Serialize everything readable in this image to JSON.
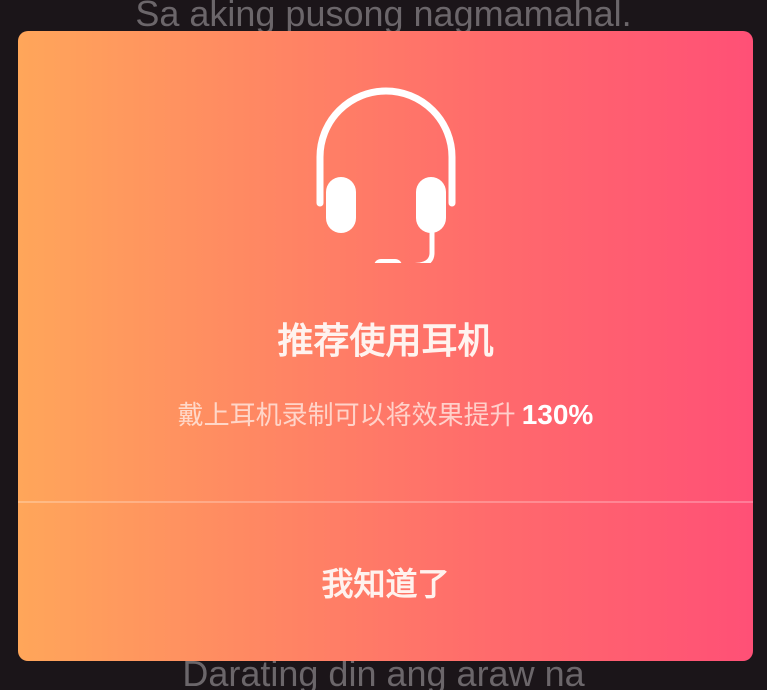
{
  "background_lyrics": {
    "top_line": "Sa aking pusong nagmamahal.",
    "bottom_line": "Darating din ang araw na"
  },
  "dialog": {
    "icon": "headset-icon",
    "title": "推荐使用耳机",
    "subtitle_text": "戴上耳机录制可以将效果提升",
    "subtitle_highlight": "130%",
    "confirm_label": "我知道了",
    "gradient_start": "#ffa65a",
    "gradient_end": "#ff5076"
  }
}
